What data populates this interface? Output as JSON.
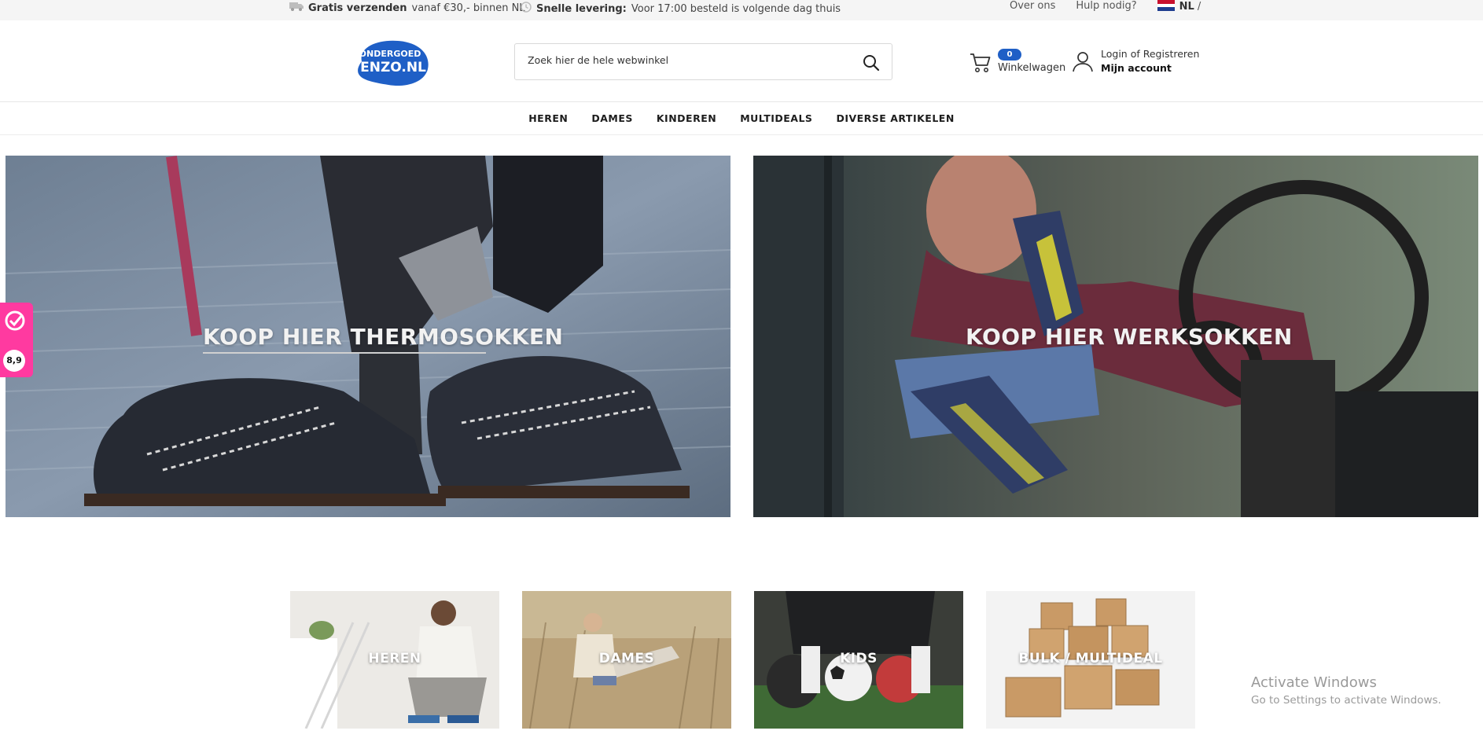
{
  "topbar": {
    "shipping_bold": "Gratis verzenden",
    "shipping_rest": "vanaf €30,- binnen NL",
    "delivery_bold": "Snelle levering:",
    "delivery_rest": "Voor 17:00 besteld is volgende dag thuis",
    "about": "Over ons",
    "help": "Hulp nodig?",
    "language": "NL",
    "language_separator": "/"
  },
  "header": {
    "logo_line1": "ONDERGOED",
    "logo_line2": "ENZO.NL",
    "search_placeholder": "Zoek hier de hele webwinkel",
    "cart_count": "0",
    "cart_label": "Winkelwagen",
    "login_label": "Login of Registreren",
    "account_label": "Mijn account"
  },
  "nav": {
    "items": [
      "HEREN",
      "DAMES",
      "KINDEREN",
      "MULTIDEALS",
      "DIVERSE ARTIKELEN"
    ]
  },
  "banners": {
    "left_title": "KOOP HIER THERMOSOKKEN",
    "right_title": "KOOP HIER WERKSOKKEN"
  },
  "categories": {
    "items": [
      "HEREN",
      "DAMES",
      "KIDS",
      "BULK / MULTIDEAL"
    ]
  },
  "rating": {
    "score": "8,9"
  },
  "watermark": {
    "line1": "Activate Windows",
    "line2": "Go to Settings to activate Windows."
  },
  "colors": {
    "brand_blue": "#1f5fc6",
    "rating_pink": "#ff3aa0"
  }
}
